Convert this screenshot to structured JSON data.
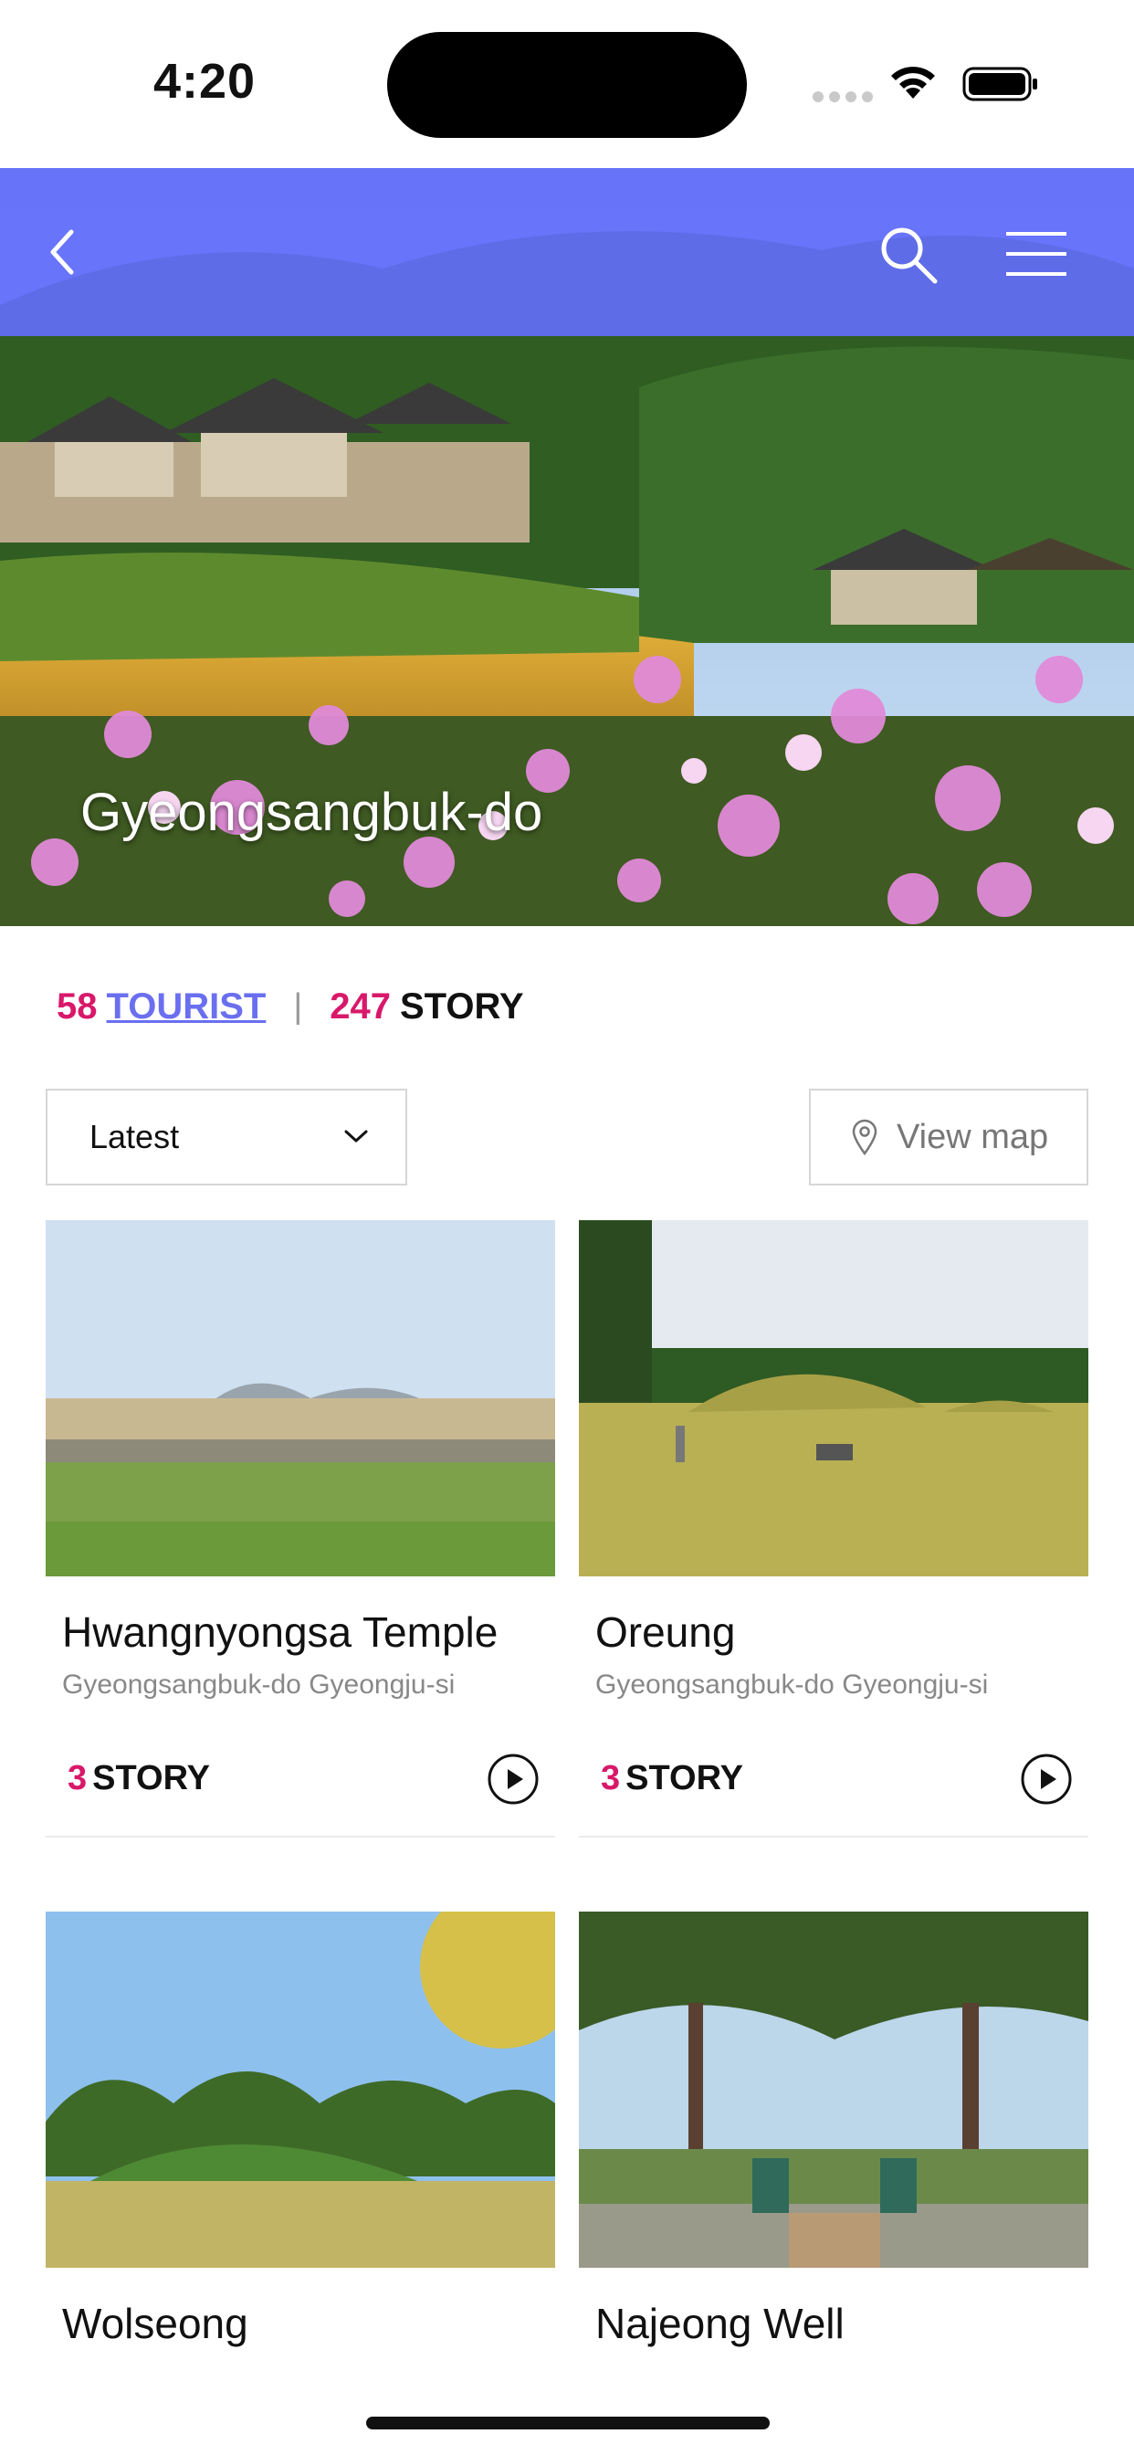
{
  "status_bar": {
    "time": "4:20"
  },
  "header": {
    "hero_title": "Gyeongsangbuk-do"
  },
  "counts": {
    "tourist_count": "58",
    "tourist_label": "TOURIST",
    "story_count": "247",
    "story_label": "STORY"
  },
  "filters": {
    "sort_value": "Latest",
    "view_map_label": "View map"
  },
  "cards": [
    {
      "title": "Hwangnyongsa Temple",
      "location": "Gyeongsangbuk-do Gyeongju-si",
      "story_count": "3",
      "story_label": "STORY"
    },
    {
      "title": "Oreung",
      "location": "Gyeongsangbuk-do Gyeongju-si",
      "story_count": "3",
      "story_label": "STORY"
    },
    {
      "title": "Wolseong",
      "location": "",
      "story_count": "",
      "story_label": ""
    },
    {
      "title": "Najeong Well",
      "location": "",
      "story_count": "",
      "story_label": ""
    }
  ],
  "colors": {
    "nav_bar": "#646efa",
    "accent_pink": "#d8186a",
    "link_blue": "#6a6ff0"
  },
  "icons": [
    "back-icon",
    "search-icon",
    "menu-icon",
    "chevron-down-icon",
    "map-pin-icon",
    "play-icon"
  ]
}
